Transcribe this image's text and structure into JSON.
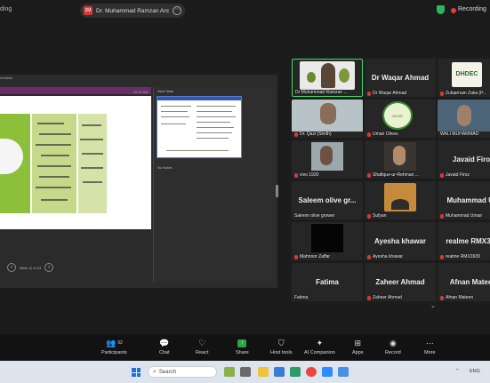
{
  "topbar": {
    "left_text": "ding",
    "sharing_badge": "3M",
    "sharing_text": "Dr. Muhammad Ramzan Ansar P...",
    "more_icon": "ellipsis-icon",
    "recording_label": "Recording",
    "colors": {
      "recording": "#e43b3b",
      "shield": "#2ab65b"
    }
  },
  "shared_screen": {
    "window_title": "entation",
    "time": "11:07 AM",
    "notes_header": "Next Slide",
    "no_notes": "No Notes",
    "slide_counter": "Slide 11 of 24",
    "thumb_title": "Launch Control Box Source Code Section",
    "thumb_left": [
      "Upcoming tests and exam",
      "Grade sheets",
      "Check on new sessions"
    ],
    "thumb_right": [
      "Other News (Data Tests)",
      "Brand Slides (Clicked)",
      "Pre Sheets Checked",
      "Box Standard/Avg Slides",
      "Sample Slide B Seasons",
      "Sample Slides Box slide",
      "Unclear Ensure Cross",
      "Box Apr Jobs Before Series"
    ]
  },
  "gallery": {
    "tiles": [
      {
        "name": "Dr Muhammad Ramzan ...",
        "big": "",
        "mic": false
      },
      {
        "name": "Dr Waqar Ahmad",
        "big": "Dr Waqar Ahmad",
        "mic": true
      },
      {
        "name": "Zulqarnain Zaka (P...",
        "big": "",
        "mic": true
      },
      {
        "name": "Dr. Qazi (Sindh)",
        "big": "",
        "mic": true
      },
      {
        "name": "Umair Olives",
        "big": "",
        "mic": true
      },
      {
        "name": "WALI MUHAMMAD",
        "big": "",
        "mic": false
      },
      {
        "name": "vivo 1920",
        "big": "",
        "mic": true
      },
      {
        "name": "Shafique-ur-Rehman ...",
        "big": "",
        "mic": true
      },
      {
        "name": "Javaid Firoz",
        "big": "Javaid Firoz",
        "mic": true
      },
      {
        "name": "Saleem olive grower",
        "big": "Saleem olive gr...",
        "mic": false
      },
      {
        "name": "Sufyan",
        "big": "",
        "mic": true
      },
      {
        "name": "Muhammad Umair",
        "big": "Muhammad  U...",
        "mic": true
      },
      {
        "name": "Mahnoor Zaffar",
        "big": "",
        "mic": true
      },
      {
        "name": "Ayesha khawar",
        "big": "Ayesha khawar",
        "mic": true
      },
      {
        "name": "realme RMX3939",
        "big": "realme RMX39...",
        "mic": true
      },
      {
        "name": "Fatima",
        "big": "Fatima",
        "mic": false
      },
      {
        "name": "Zaheer Ahmad",
        "big": "Zaheer Ahmad",
        "mic": true
      },
      {
        "name": "Afnan Mateen",
        "big": "Afnan Mateen",
        "mic": true
      }
    ],
    "logo_text": "DHDEC",
    "olive_text": "OLIVE PAKISTAN"
  },
  "toolbar": {
    "participants_label": "Participants",
    "participants_count": "92",
    "chat_label": "Chat",
    "react_label": "React",
    "share_label": "Share",
    "host_tools_label": "Host tools",
    "ai_companion_label": "AI Companion",
    "apps_label": "Apps",
    "record_label": "Record",
    "more_label": "More"
  },
  "taskbar": {
    "search_placeholder": "Search",
    "lang": "ENG"
  }
}
